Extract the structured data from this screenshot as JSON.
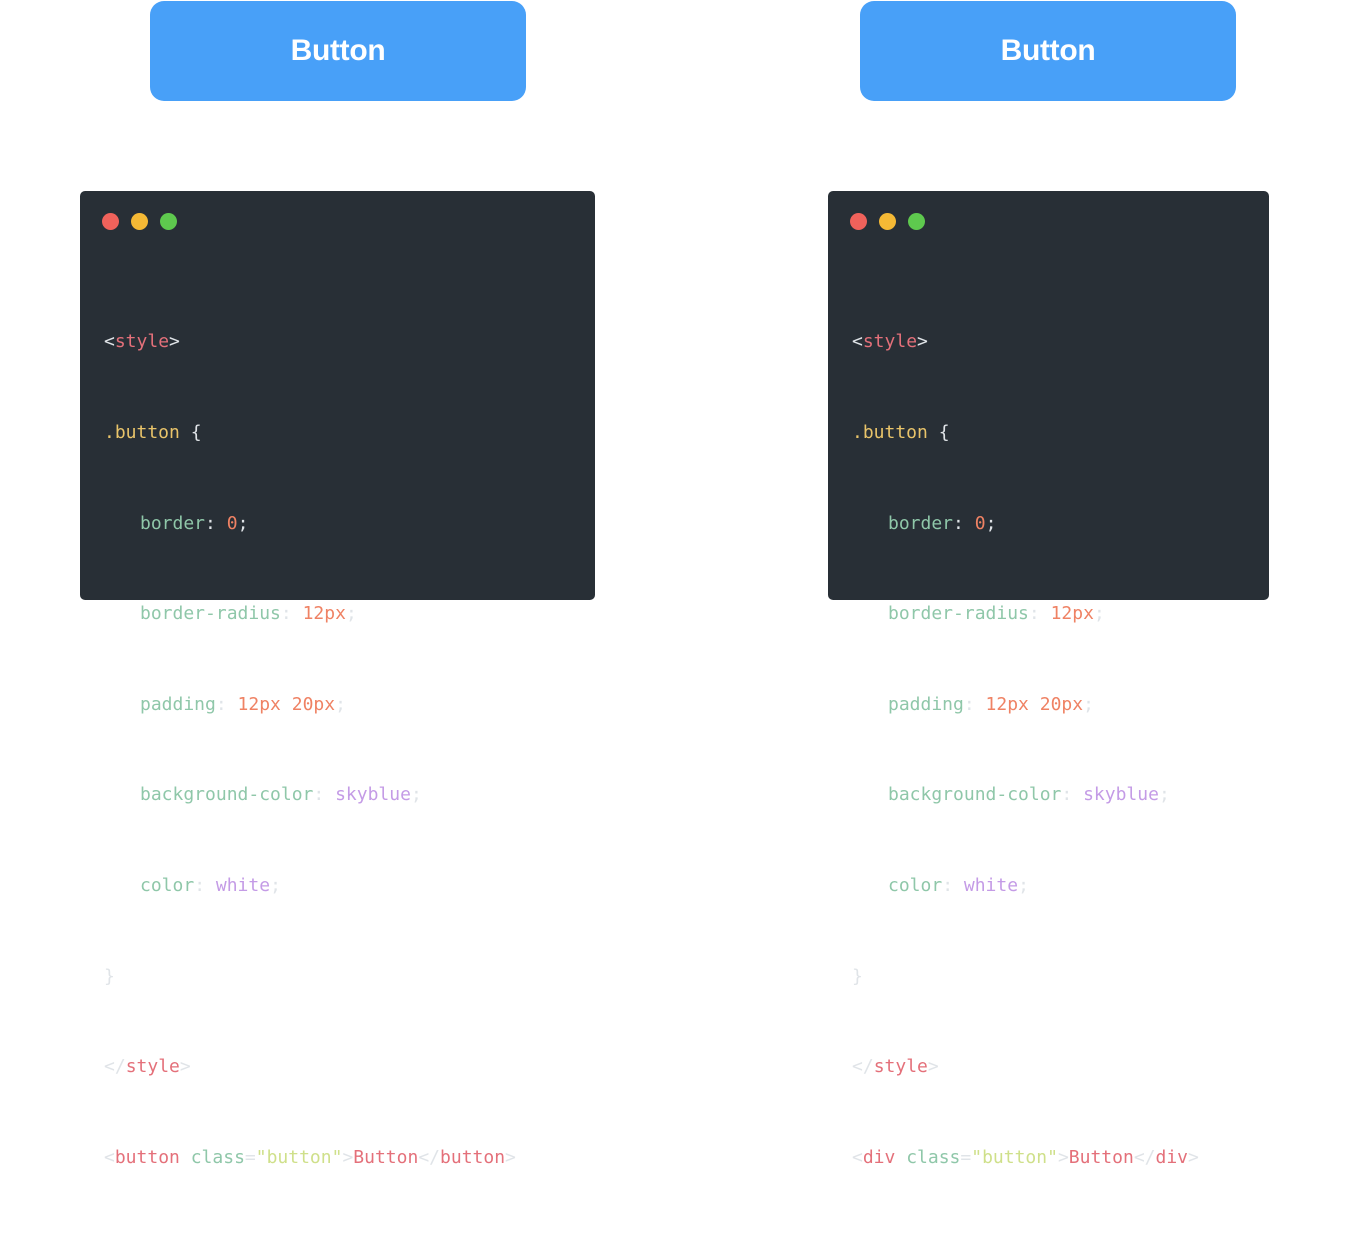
{
  "buttons": {
    "left_label": "Button",
    "right_label": "Button",
    "color": "#48a0f8"
  },
  "windows": {
    "background": "#282f36",
    "dot_colors": [
      "#f0625b",
      "#f5b935",
      "#5ec94e"
    ],
    "left": {
      "style_open_lt": "<",
      "style_open_tag": "style",
      "style_open_gt": ">",
      "selector": ".button",
      "brace_open": " {",
      "border_prop": "border",
      "border_val": "0",
      "radius_prop": "border-radius",
      "radius_val": "12px",
      "padding_prop": "padding",
      "padding_val": "12px 20px",
      "bg_prop": "background-color",
      "bg_val": "skyblue",
      "color_prop": "color",
      "color_val": "white",
      "brace_close": "}",
      "style_close_lt": "</",
      "style_close_tag": "style",
      "style_close_gt": ">",
      "el_lt": "<",
      "el_tag": "button",
      "el_attr": "class",
      "el_eq": "=",
      "el_str": "\"button\"",
      "el_gt": ">",
      "el_text": "Button",
      "el_close_lt": "</",
      "el_close_tag": "button",
      "el_close_gt": ">"
    },
    "right": {
      "style_open_lt": "<",
      "style_open_tag": "style",
      "style_open_gt": ">",
      "selector": ".button",
      "brace_open": " {",
      "border_prop": "border",
      "border_val": "0",
      "radius_prop": "border-radius",
      "radius_val": "12px",
      "padding_prop": "padding",
      "padding_val": "12px 20px",
      "bg_prop": "background-color",
      "bg_val": "skyblue",
      "color_prop": "color",
      "color_val": "white",
      "brace_close": "}",
      "style_close_lt": "</",
      "style_close_tag": "style",
      "style_close_gt": ">",
      "el_lt": "<",
      "el_tag": "div",
      "el_attr": "class",
      "el_eq": "=",
      "el_str": "\"button\"",
      "el_gt": ">",
      "el_text": "Button",
      "el_close_lt": "</",
      "el_close_tag": "div",
      "el_close_gt": ">"
    }
  }
}
